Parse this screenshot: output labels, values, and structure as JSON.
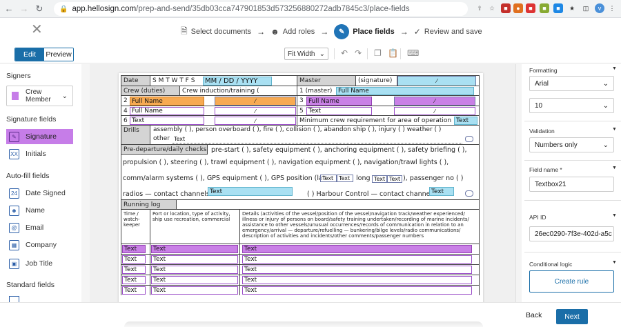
{
  "browser": {
    "url_host": "app.hellosign.com",
    "url_path": "/prep-and-send/35db03cca747901853d573256880272adb7845c3/place-fields",
    "avatar_letter": "v"
  },
  "header": {
    "steps": [
      {
        "label": "Select documents"
      },
      {
        "label": "Add roles"
      },
      {
        "label": "Place fields"
      },
      {
        "label": "Review and save"
      }
    ]
  },
  "toolbar": {
    "edit_label": "Edit",
    "preview_label": "Preview",
    "zoom_value": "Fit Width"
  },
  "sidebar": {
    "signers_title": "Signers",
    "signer_name": "Crew Member",
    "signer_color": "#c67de8",
    "signature_fields_title": "Signature fields",
    "signature_items": [
      {
        "label": "Signature",
        "icon": "pen-icon"
      },
      {
        "label": "Initials",
        "icon": "XX"
      }
    ],
    "autofill_title": "Auto-fill fields",
    "autofill_items": [
      {
        "label": "Date Signed",
        "icon": "calendar-icon"
      },
      {
        "label": "Name",
        "icon": "person-icon"
      },
      {
        "label": "Email",
        "icon": "at-icon"
      },
      {
        "label": "Company",
        "icon": "building-icon"
      },
      {
        "label": "Job Title",
        "icon": "briefcase-icon"
      }
    ],
    "standard_title": "Standard fields"
  },
  "document": {
    "date_label": "Date",
    "days": "S M T W T F S",
    "date_field": "MM / DD / YYYY",
    "master_label": "Master",
    "master_sig": "(signature)",
    "crew_duties": "Crew (duties)",
    "crew_induction": "Crew induction/training (",
    "master_num": "1 (master)",
    "full_name": "Full Name",
    "text": "Text",
    "min_crew": "Minimum crew requirement for area of operation",
    "drills_label": "Drills",
    "drills_text": "assembly (  ), person overboard (  ), fire (  ), collision (  ), abandon ship (  ), injury (  ) weather (  )",
    "other_label": "other",
    "predep_label": "Pre-departure/daily checks",
    "predep_line1": "pre-start (  ), safety equipment (  ), anchoring equipment (  ), safety briefing (  ),",
    "predep_line2": "propulsion (  ), steering (  ), trawl equipment (  ), navigation equipment (  ), navigation/trawl lights (  ),",
    "predep_line3": "comm/alarm systems (  ), GPS equipment (  ), GPS position (lat",
    "predep_line3b": "long",
    "predep_line3c": "), passenger no (  )",
    "predep_line4a": "radios — contact channels",
    "predep_line4b": "( ) Harbour Control — contact channels",
    "running_log": "Running log",
    "col1": "Time / watch-keeper",
    "col2": "Port or location, type of activity, ship use recreation, commercial",
    "col3": "Details (activities of the vessel/position of the vessel/navigation track/weather experienced/ illness or injury of persons on board/safety training undertaken/recording of marine incidents/ assistance to other vessels/unusual occurrences/records of communication in relation to an emergency/arrival — departure/refuelling — bunkering/bilge levels/radio communications/ description of activities and incidents/other comments/passenger numbers"
  },
  "right_panel": {
    "formatting_title": "Formatting",
    "font_value": "Arial",
    "size_value": "10",
    "validation_title": "Validation",
    "validation_value": "Numbers only",
    "field_name_title": "Field name *",
    "field_name_value": "Textbox21",
    "api_id_title": "API ID",
    "api_id_value": "26ec0290-7f3e-402d-a5c",
    "conditional_title": "Conditional logic",
    "create_rule": "Create rule"
  },
  "footer": {
    "back": "Back",
    "next": "Next"
  },
  "colors": {
    "accent": "#1a6ea8",
    "signer": "#c67de8",
    "orange_field": "#f7aa52",
    "blue_field": "#a9e0f2"
  }
}
